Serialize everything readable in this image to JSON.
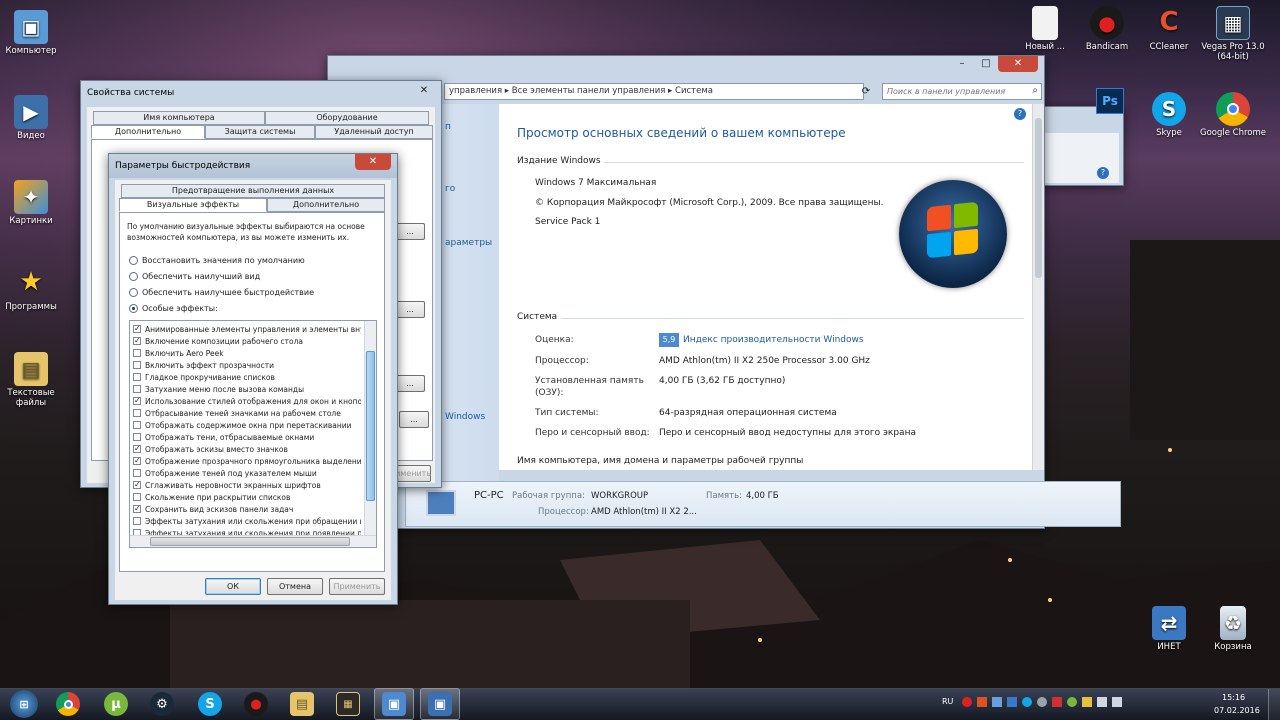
{
  "desktop": {
    "icons_left": [
      {
        "label": "Компьютер",
        "icon": "computer-icon"
      },
      {
        "label": "Видео",
        "icon": "video-folder-icon"
      },
      {
        "label": "Картинки",
        "icon": "pictures-folder-icon"
      },
      {
        "label": "Программы",
        "icon": "programs-star-icon"
      },
      {
        "label": "Текстовые файлы",
        "icon": "text-files-folder-icon"
      }
    ],
    "icons_right": [
      {
        "label": "Новый ...",
        "icon": "new-document-icon"
      },
      {
        "label": "Bandicam",
        "icon": "bandicam-icon"
      },
      {
        "label": "CCleaner",
        "icon": "ccleaner-icon"
      },
      {
        "label": "Vegas Pro 13.0 (64-bit)",
        "icon": "vegas-pro-icon"
      },
      {
        "label": "Skype",
        "icon": "skype-icon"
      },
      {
        "label": "Google Chrome",
        "icon": "chrome-icon"
      },
      {
        "label": "ИНЕТ",
        "icon": "network-icon"
      },
      {
        "label": "Корзина",
        "icon": "recycle-bin-icon"
      }
    ]
  },
  "sysinfo": {
    "breadcrumb": [
      "управления",
      "Все элементы панели управления",
      "Система"
    ],
    "search_placeholder": "Поиск в панели управления",
    "heading": "Просмотр основных сведений о вашем компьютере",
    "sidebar_fragments": [
      "п",
      "го",
      "араметры",
      "Windows"
    ],
    "edition_section": "Издание Windows",
    "edition": "Windows 7 Максимальная",
    "copyright": "© Корпорация Майкрософт (Microsoft Corp.), 2009. Все права защищены.",
    "service_pack": "Service Pack 1",
    "system_section": "Система",
    "rows": [
      {
        "label": "Оценка:",
        "value": "Индекс производительности Windows",
        "badge": "5,9"
      },
      {
        "label": "Процессор:",
        "value": "AMD Athlon(tm) II X2 250e Processor   3.00 GHz"
      },
      {
        "label": "Установленная память (ОЗУ):",
        "value": "4,00 ГБ (3,62 ГБ доступно)"
      },
      {
        "label": "Тип системы:",
        "value": "64-разрядная операционная система"
      },
      {
        "label": "Перо и сенсорный ввод:",
        "value": "Перо и сенсорный ввод недоступны для этого экрана"
      }
    ],
    "name_section": "Имя компьютера, имя домена и параметры рабочей группы"
  },
  "details_pane": {
    "pc_name": "PC-PC",
    "workgroup_label": "Рабочая группа:",
    "workgroup": "WORKGROUP",
    "memory_label": "Память:",
    "memory": "4,00 ГБ",
    "cpu_label": "Процессор:",
    "cpu": "AMD Athlon(tm) II X2 2..."
  },
  "sysprops": {
    "title": "Свойства системы",
    "tabs_row1": [
      "Имя компьютера",
      "Оборудование"
    ],
    "tabs_row2": [
      "Дополнительно",
      "Защита системы",
      "Удаленный доступ"
    ],
    "apply": "Применить"
  },
  "perf": {
    "title": "Параметры быстродействия",
    "tab_top": "Предотвращение выполнения данных",
    "tab_visual": "Визуальные эффекты",
    "tab_advanced": "Дополнительно",
    "intro": "По умолчанию визуальные эффекты выбираются на основе возможностей компьютера, из вы можете изменить их.",
    "radios": [
      {
        "label": "Восстановить значения по умолчанию",
        "checked": false
      },
      {
        "label": "Обеспечить наилучший вид",
        "checked": false
      },
      {
        "label": "Обеспечить наилучшее быстродействие",
        "checked": false
      },
      {
        "label": "Особые эффекты:",
        "checked": true
      }
    ],
    "effects": [
      {
        "label": "Анимированные элементы управления и элементы вну",
        "checked": true
      },
      {
        "label": "Включение композиции рабочего стола",
        "checked": true
      },
      {
        "label": "Включить Aero Peek",
        "checked": false
      },
      {
        "label": "Включить эффект прозрачности",
        "checked": false
      },
      {
        "label": "Гладкое прокручивание списков",
        "checked": false
      },
      {
        "label": "Затухание меню после вызова команды",
        "checked": false
      },
      {
        "label": "Использование стилей отображения для окон и кнопо",
        "checked": true
      },
      {
        "label": "Отбрасывание теней значками на рабочем столе",
        "checked": false
      },
      {
        "label": "Отображать содержимое окна при перетаскивании",
        "checked": false
      },
      {
        "label": "Отображать тени, отбрасываемые окнами",
        "checked": false
      },
      {
        "label": "Отображать эскизы вместо значков",
        "checked": true
      },
      {
        "label": "Отображение прозрачного прямоугольника выделени",
        "checked": true
      },
      {
        "label": "Отображение теней под указателем мыши",
        "checked": false
      },
      {
        "label": "Сглаживать неровности экранных шрифтов",
        "checked": true
      },
      {
        "label": "Скольжение при раскрытии списков",
        "checked": false
      },
      {
        "label": "Сохранить вид эскизов панели задач",
        "checked": true
      },
      {
        "label": "Эффекты затухания или скольжения при обращении к",
        "checked": false
      },
      {
        "label": "Эффекты затухания или скольжения при появлении п",
        "checked": false
      }
    ],
    "ok": "ОК",
    "cancel": "Отмена",
    "apply": "Применить"
  },
  "taskbar": {
    "lang": "RU",
    "time": "15:16",
    "date": "07.02.2016",
    "items": [
      "start-orb-icon",
      "chrome-icon",
      "utorrent-icon",
      "steam-icon",
      "skype-icon",
      "bandicam-icon",
      "file-explorer-icon",
      "media-icon",
      "control-panel-icon",
      "system-properties-icon"
    ]
  },
  "colors": {
    "accent": "#1e5aa0",
    "link": "#1e5aa0",
    "heading": "#1e5aa0"
  }
}
